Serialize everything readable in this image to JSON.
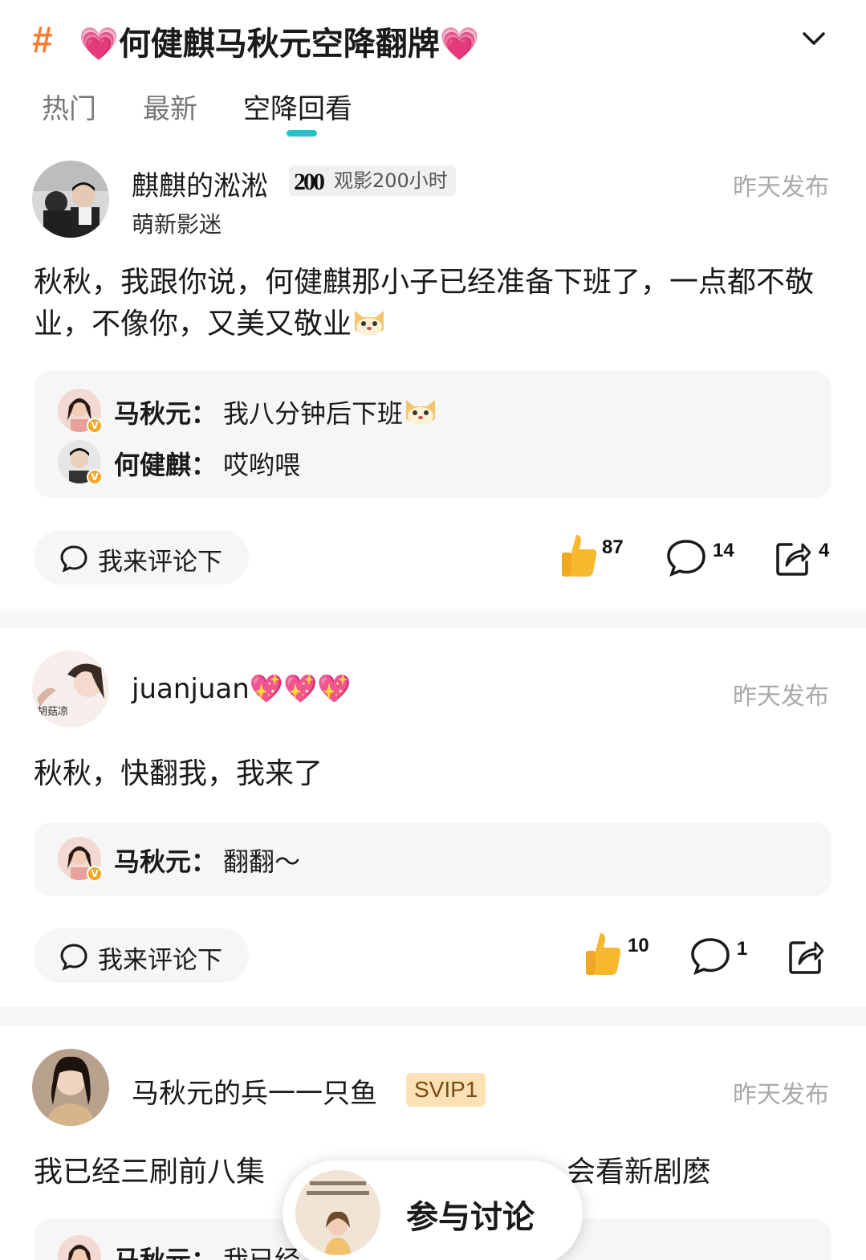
{
  "header": {
    "hash_icon": "#",
    "heart_left": "💗",
    "title": "何健麒马秋元空降翻牌",
    "heart_right": "💗",
    "expand_icon": "chevron-down-icon"
  },
  "tabs": [
    {
      "label": "热门",
      "active": false
    },
    {
      "label": "最新",
      "active": false
    },
    {
      "label": "空降回看",
      "active": true
    }
  ],
  "colors": {
    "accent": "#22c3c9",
    "hash": "#ff7a2e",
    "thumb": "#f5b82e"
  },
  "posts": [
    {
      "username": "麒麒的淞淞",
      "badge_mark": "200",
      "badge_text": "观影200小时",
      "level": "萌新影迷",
      "time": "昨天发布",
      "content": "秋秋，我跟你说，何健麒那小子已经准备下班了，一点都不敬业，不像你，又美又敬业",
      "replies": [
        {
          "name": "马秋元：",
          "text": "我八分钟后下班"
        },
        {
          "name": "何健麒：",
          "text": "哎哟喂"
        }
      ],
      "comment_placeholder": "我来评论下",
      "likes": "87",
      "comments": "14",
      "shares": "4"
    },
    {
      "username": "juanjuan",
      "username_hearts": "💖💖💖",
      "time": "昨天发布",
      "content": "秋秋，快翻我，我来了",
      "replies": [
        {
          "name": "马秋元：",
          "text": "翻翻～"
        }
      ],
      "comment_placeholder": "我来评论下",
      "likes": "10",
      "comments": "1",
      "shares": ""
    },
    {
      "username": "马秋元的兵一一只鱼",
      "badge_svip": "SVIP1",
      "time": "昨天发布",
      "content_left": "我已经三刷前八集",
      "content_right": "会看新剧麽",
      "replies": [
        {
          "name": "马秋元：",
          "text": "我已经"
        }
      ]
    }
  ],
  "fab": {
    "label": "参与讨论"
  }
}
